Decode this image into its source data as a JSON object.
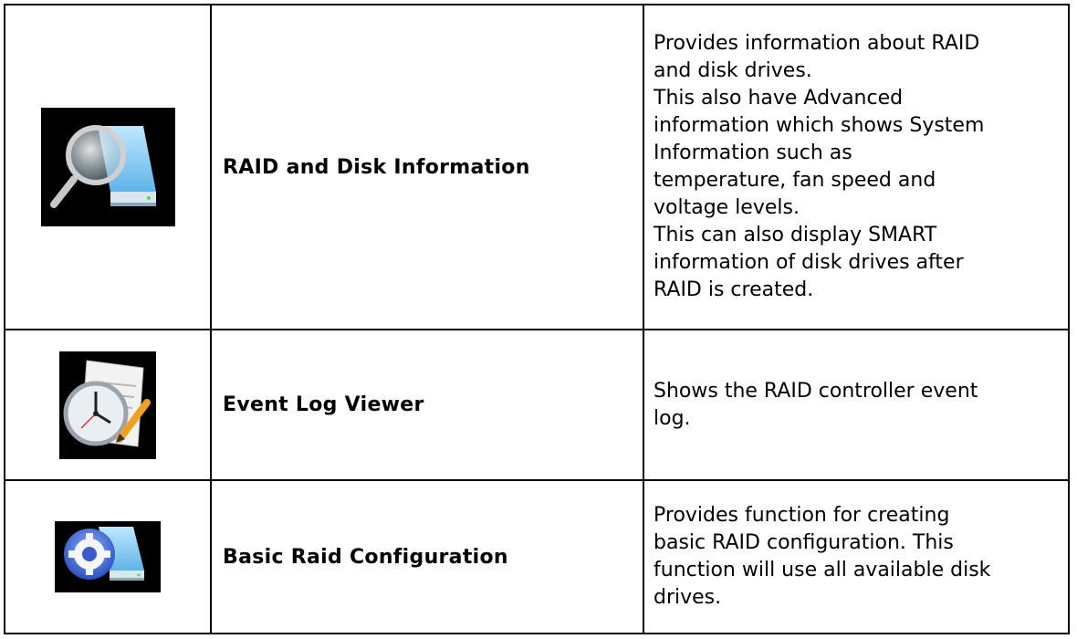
{
  "rows": [
    {
      "icon": "raid-disk-info-icon",
      "name": "RAID and Disk Information",
      "description": [
        "Provides information about RAID",
        "and disk drives.",
        "This also have Advanced",
        "information which shows System",
        "Information such as",
        "temperature, fan speed and",
        "voltage levels.",
        "This can also display SMART",
        "information of disk drives after",
        "RAID is created."
      ]
    },
    {
      "icon": "event-log-icon",
      "name": "Event Log Viewer",
      "description": [
        "Shows the RAID controller event",
        "log."
      ]
    },
    {
      "icon": "raid-configuration-icon",
      "name": "Basic Raid Configuration",
      "description": [
        "Provides function for creating",
        "basic RAID configuration. This",
        "function will use all available disk",
        "drives."
      ]
    }
  ],
  "colors": {
    "border": "#000000",
    "icon_background": "#000000",
    "disk_blue": "#7ec8f0"
  }
}
